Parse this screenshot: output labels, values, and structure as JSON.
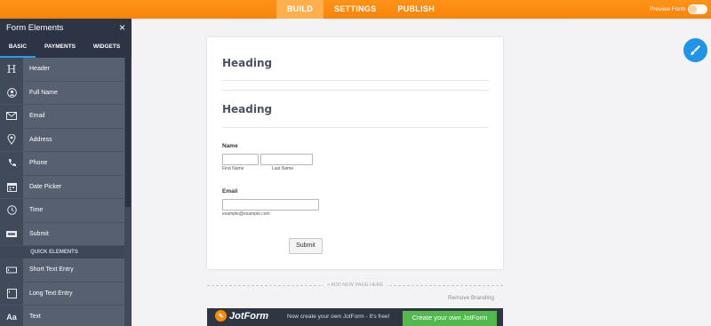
{
  "topbar": {
    "tabs": [
      "BUILD",
      "SETTINGS",
      "PUBLISH"
    ],
    "preview_label": "Preview Form"
  },
  "sidebar": {
    "title": "Form Elements",
    "close": "×",
    "tabs": [
      "BASIC",
      "PAYMENTS",
      "WIDGETS"
    ],
    "items": [
      {
        "label": "Header",
        "icon": "header-icon"
      },
      {
        "label": "Full Name",
        "icon": "person-icon"
      },
      {
        "label": "Email",
        "icon": "envelope-icon"
      },
      {
        "label": "Address",
        "icon": "location-pin-icon"
      },
      {
        "label": "Phone",
        "icon": "phone-icon"
      },
      {
        "label": "Date Picker",
        "icon": "calendar-icon"
      },
      {
        "label": "Time",
        "icon": "clock-icon"
      },
      {
        "label": "Submit",
        "icon": "submit-icon"
      }
    ],
    "section_label": "QUICK ELEMENTS",
    "quick_items": [
      {
        "label": "Short Text Entry",
        "icon": "short-text-icon"
      },
      {
        "label": "Long Text Entry",
        "icon": "long-text-icon"
      },
      {
        "label": "Text",
        "icon": "text-icon"
      }
    ]
  },
  "form": {
    "heading1": "Heading",
    "heading2": "Heading",
    "name_label": "Name",
    "first_name_sub": "First Name",
    "last_name_sub": "Last Name",
    "email_label": "Email",
    "email_sub": "example@example.com",
    "submit": "Submit"
  },
  "footer": {
    "add_page": "+ ADD NEW PAGE HERE",
    "remove_branding": "Remove Branding",
    "logo_text": "JotForm",
    "promo": "Now create your own JotForm - It's free!",
    "cta": "Create your own JotForm"
  },
  "colors": {
    "accent": "#f8830b",
    "sidebar": "#566071",
    "fab": "#1f94e9",
    "cta": "#53b94f"
  }
}
